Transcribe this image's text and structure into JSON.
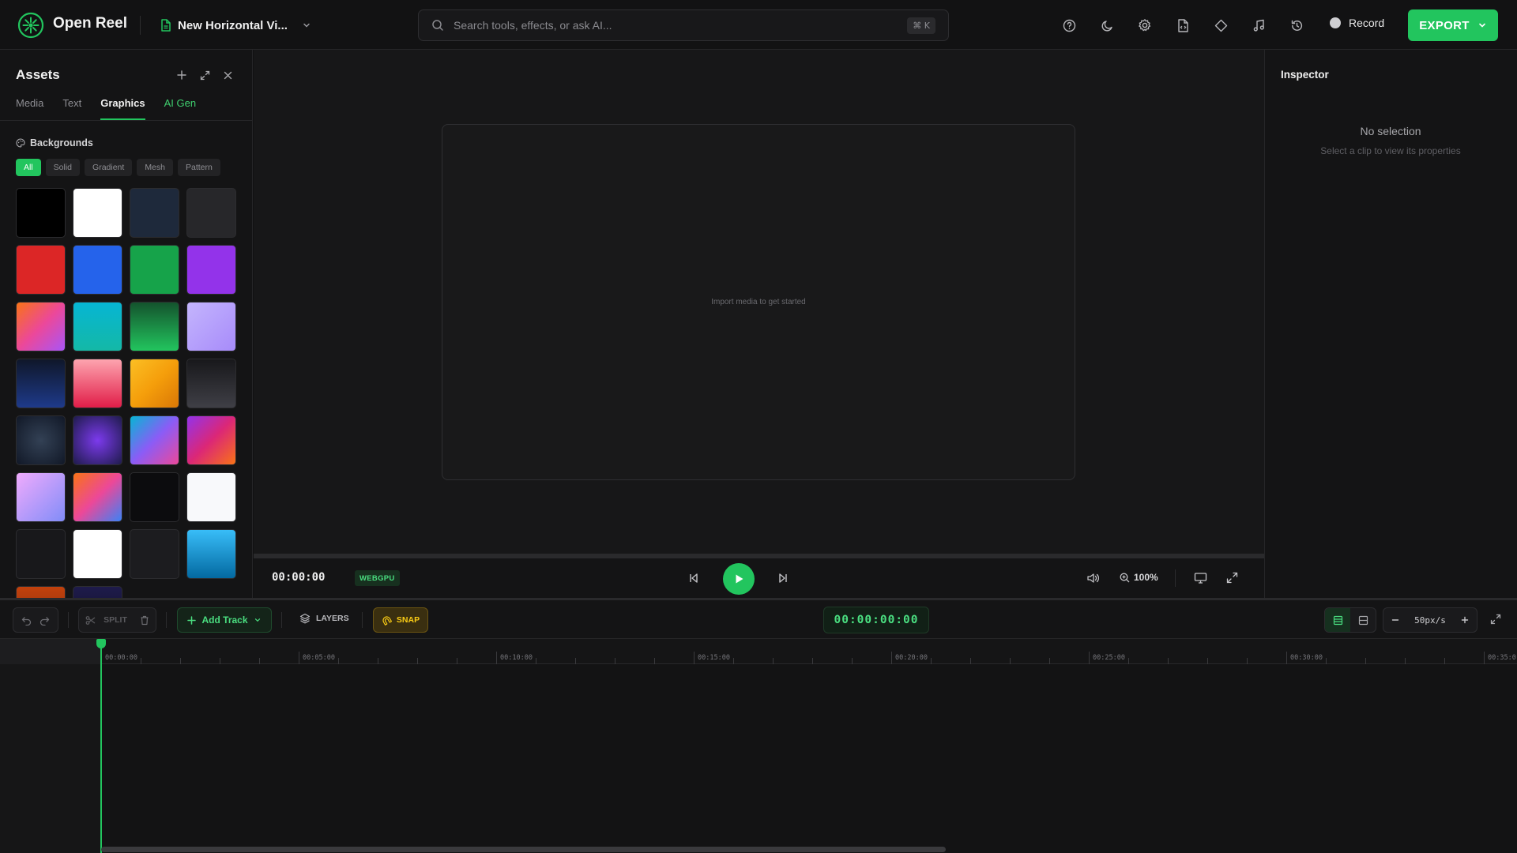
{
  "app": {
    "title": "Open Reel",
    "project_name": "New Horizontal Vi...",
    "colors": {
      "accent": "#22c55e",
      "snap": "#facc15"
    }
  },
  "search": {
    "placeholder": "Search tools, effects, or ask AI...",
    "shortcut": "⌘ K"
  },
  "toolbar": {
    "icons": [
      "help-icon",
      "moon-icon",
      "gear-icon",
      "file-code-icon",
      "diamond-icon",
      "music-note-icon",
      "history-icon"
    ],
    "record_label": "Record",
    "export_label": "EXPORT"
  },
  "assets": {
    "title": "Assets",
    "tabs": [
      {
        "label": "Media",
        "active": false
      },
      {
        "label": "Text",
        "active": false
      },
      {
        "label": "Graphics",
        "active": true
      },
      {
        "label": "AI Gen",
        "active": false
      }
    ],
    "section_title": "Backgrounds",
    "filters": [
      {
        "label": "All",
        "active": true
      },
      {
        "label": "Solid",
        "active": false
      },
      {
        "label": "Gradient",
        "active": false
      },
      {
        "label": "Mesh",
        "active": false
      },
      {
        "label": "Pattern",
        "active": false
      }
    ],
    "swatches": [
      "#000000",
      "#ffffff",
      "#1e293b",
      "#27272a",
      "#dc2626",
      "#2563eb",
      "#16a34a",
      "#9333ea",
      "linear-gradient(135deg,#f97316,#ec4899,#a855f7)",
      "linear-gradient(180deg,#06b6d4,#14b8a6)",
      "linear-gradient(180deg,#14532d,#22c55e)",
      "linear-gradient(135deg,#c4b5fd,#a78bfa)",
      "linear-gradient(180deg,#0f172a,#1e3a8a)",
      "linear-gradient(180deg,#fda4af,#e11d48)",
      "linear-gradient(135deg,#fbbf24,#f59e0b,#d97706)",
      "linear-gradient(180deg,#18181b,#3f3f46)",
      "radial-gradient(circle,#334155,#111827)",
      "radial-gradient(circle,#7c3aed,#1e1b4b)",
      "linear-gradient(135deg,#06b6d4,#8b5cf6,#ec4899)",
      "linear-gradient(135deg,#9333ea,#db2777,#f97316)",
      "linear-gradient(135deg,#f0abfc,#818cf8)",
      "linear-gradient(135deg,#f97316,#ec4899,#3b82f6)",
      "#0c0c0e",
      "#f8f9fb",
      "#18181b",
      "#ffffff",
      "#1c1c1f",
      "linear-gradient(180deg,#38bdf8,#0369a1)",
      "linear-gradient(180deg,#c2410c,#7c2d12)",
      "linear-gradient(180deg,#1e1b4b,#0f0f23)"
    ]
  },
  "preview": {
    "empty_hint": "Import media to get started",
    "timecode": "00:00:00",
    "renderer_badge": "WEBGPU",
    "zoom": "100%"
  },
  "inspector": {
    "title": "Inspector",
    "empty_title": "No selection",
    "empty_subtitle": "Select a clip to view its properties"
  },
  "timeline": {
    "split_label": "SPLIT",
    "add_track_label": "Add Track",
    "layers_label": "LAYERS",
    "snap_label": "SNAP",
    "timecode": "00:00:00:00",
    "zoom_label": "50px/s",
    "ruler_labels": [
      "00:00:00",
      "00:05:00",
      "00:10:00",
      "00:15:00",
      "00:20:00",
      "00:25:00",
      "00:30:00",
      "00:35:0"
    ]
  }
}
